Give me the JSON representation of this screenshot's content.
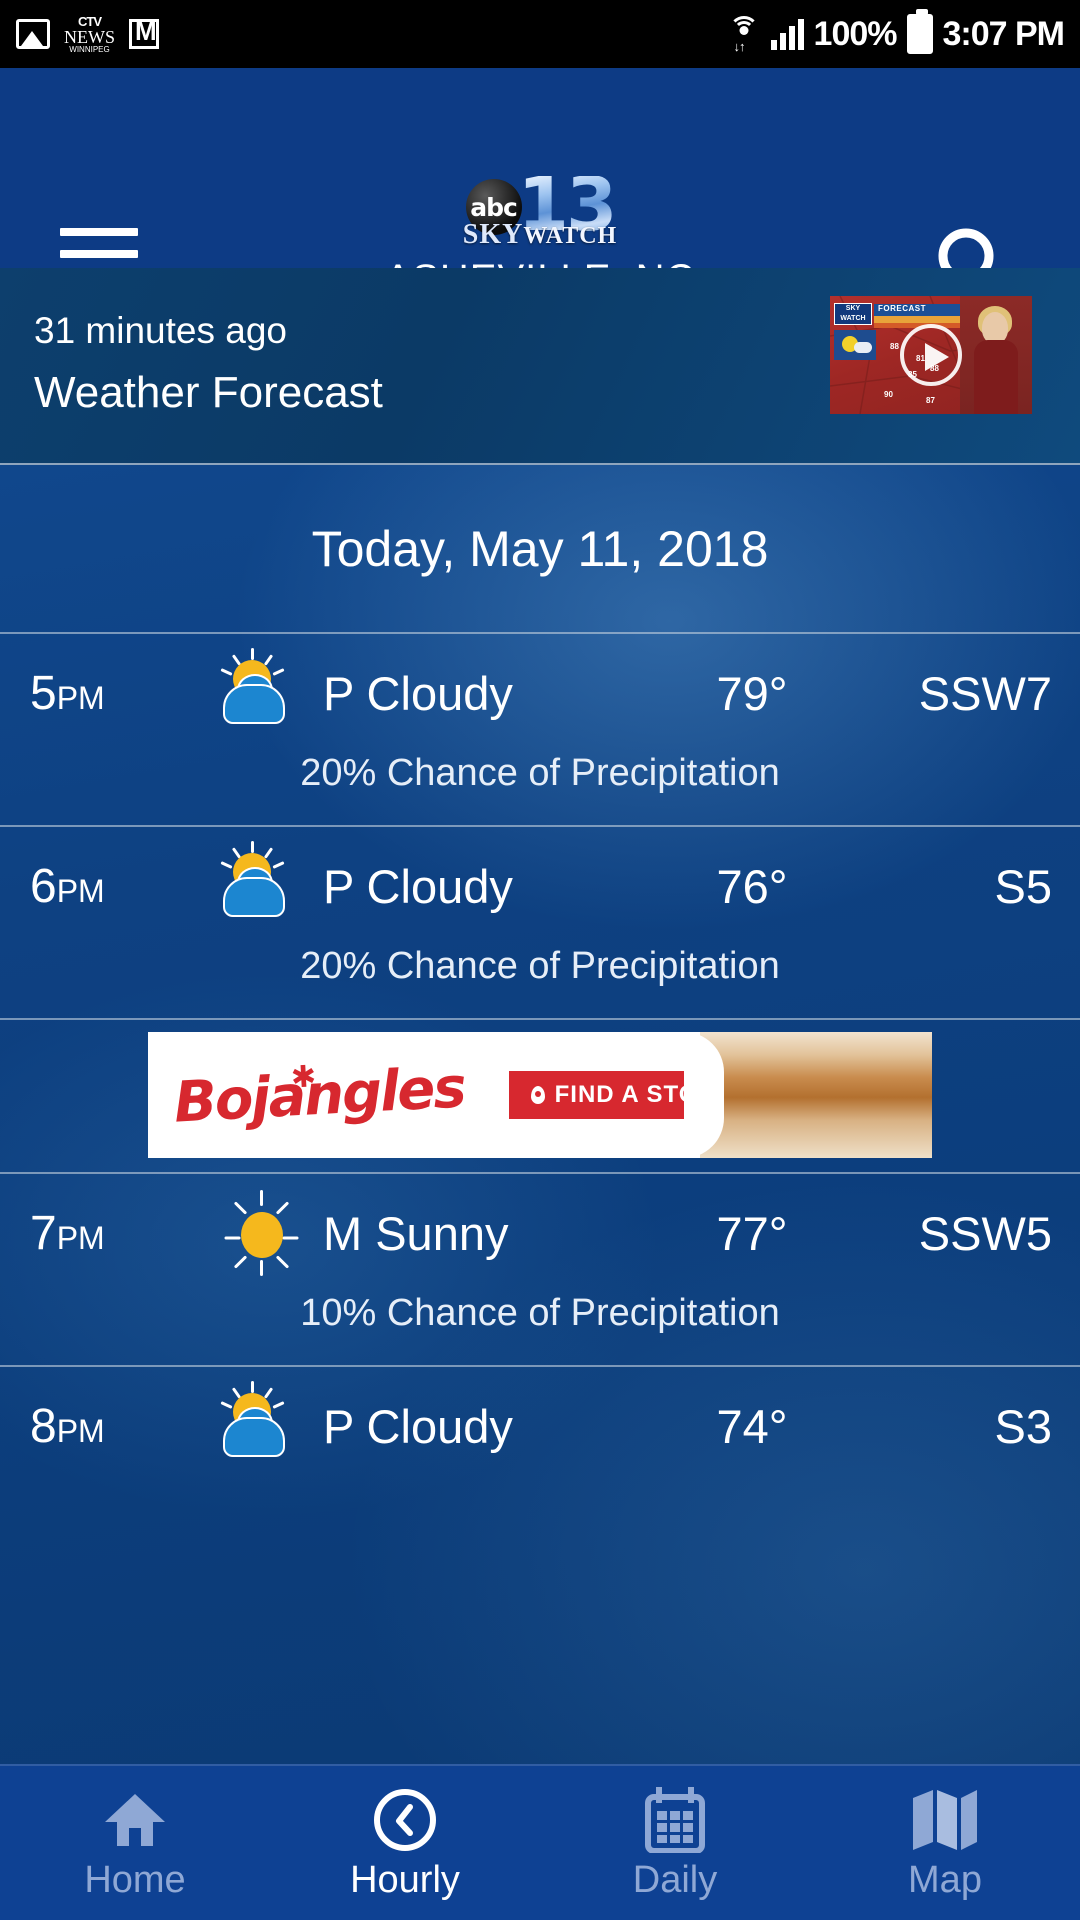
{
  "status_bar": {
    "icons_left": [
      "photo-icon",
      "ctv-news-winnipeg-icon",
      "gmail-icon"
    ],
    "ctv_line1": "CTV",
    "ctv_line2": "NEWS",
    "ctv_line3": "WINNIPEG",
    "gmail_glyph": "M",
    "wifi_label": "wifi-icon",
    "battery_text": "100%",
    "clock": "3:07 PM"
  },
  "header": {
    "menu_icon": "hamburger-menu-icon",
    "search_icon": "search-icon",
    "logo_abc": "abc",
    "logo_number": "13",
    "logo_sky": "SKY",
    "logo_watch": "WATCH",
    "location": "ASHEVILLE, NC",
    "background_color": "#0d3b85"
  },
  "video_card": {
    "time_ago": "31 minutes ago",
    "title": "Weather Forecast",
    "thumbnail_label": "FORECAST",
    "thumbnail_badge": "SKY WATCH",
    "play_icon": "play-button-icon"
  },
  "date_header": "Today, May 11, 2018",
  "hours": [
    {
      "time": "5",
      "ampm": "PM",
      "icon": "partly-cloudy-icon",
      "condition": "P Cloudy",
      "temperature": "79°",
      "wind": "SSW7",
      "precipitation": "20% Chance of Precipitation"
    },
    {
      "time": "6",
      "ampm": "PM",
      "icon": "partly-cloudy-icon",
      "condition": "P Cloudy",
      "temperature": "76°",
      "wind": "S5",
      "precipitation": "20% Chance of Precipitation"
    },
    {
      "time": "7",
      "ampm": "PM",
      "icon": "sunny-icon",
      "condition": "M Sunny",
      "temperature": "77°",
      "wind": "SSW5",
      "precipitation": "10% Chance of Precipitation"
    },
    {
      "time": "8",
      "ampm": "PM",
      "icon": "partly-cloudy-icon",
      "condition": "P Cloudy",
      "temperature": "74°",
      "wind": "S3",
      "precipitation": ""
    }
  ],
  "ad": {
    "brand": "Bojangles",
    "cta": "FIND A STORE",
    "pin_icon": "location-pin-icon",
    "brand_color": "#d7282f"
  },
  "bottom_nav": {
    "items": [
      {
        "label": "Home",
        "icon": "home-icon",
        "active": false
      },
      {
        "label": "Hourly",
        "icon": "clock-icon",
        "active": true
      },
      {
        "label": "Daily",
        "icon": "calendar-icon",
        "active": false
      },
      {
        "label": "Map",
        "icon": "map-icon",
        "active": false
      }
    ]
  }
}
